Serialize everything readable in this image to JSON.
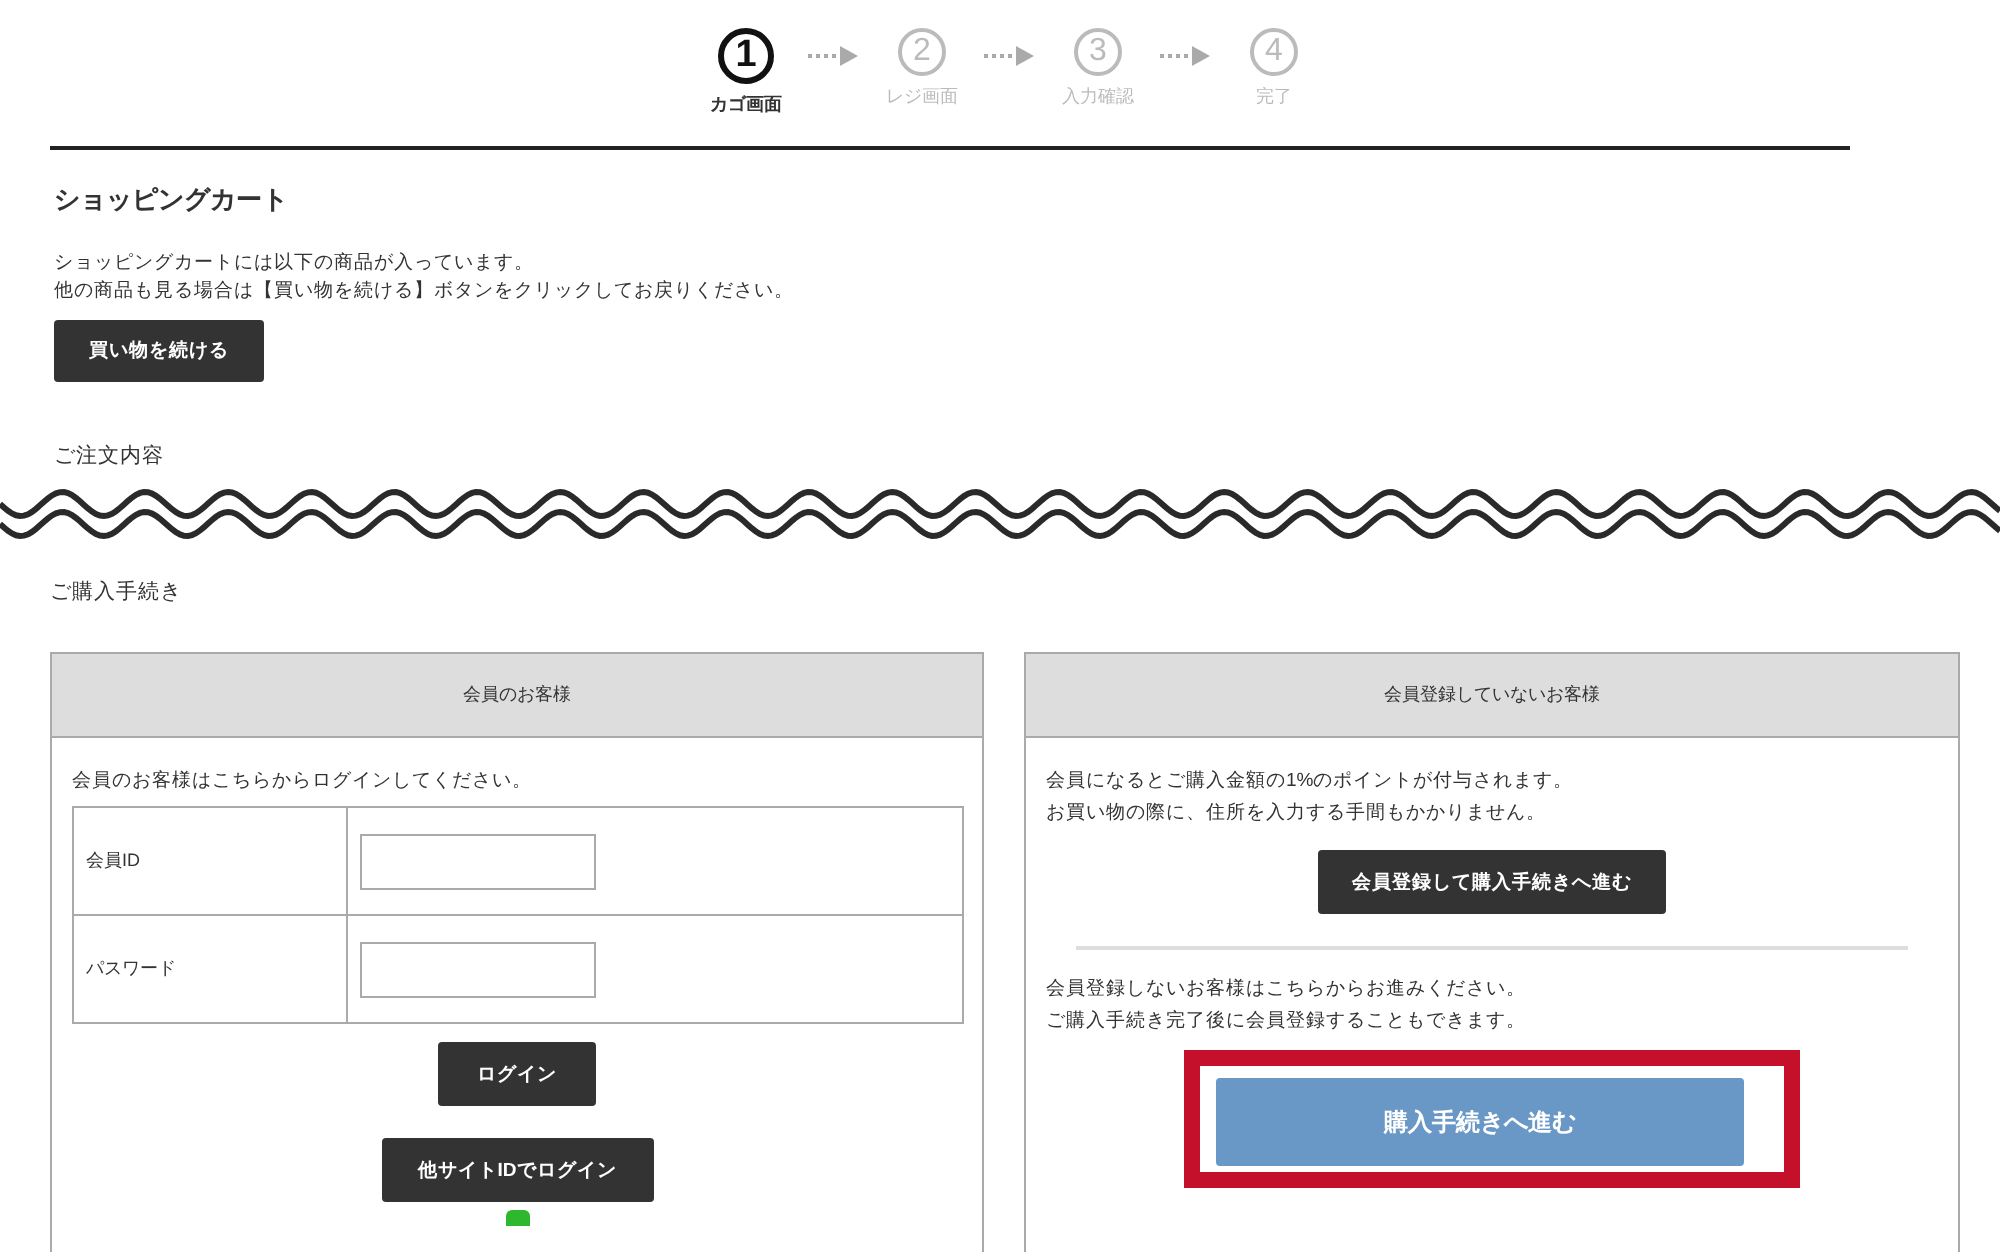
{
  "steps": [
    {
      "number": "1",
      "label": "カゴ画面",
      "selected": true
    },
    {
      "number": "2",
      "label": "レジ画面",
      "selected": false
    },
    {
      "number": "3",
      "label": "入力確認",
      "selected": false
    },
    {
      "number": "4",
      "label": "完了",
      "selected": false
    }
  ],
  "cart": {
    "title": "ショッピングカート",
    "lines": [
      "ショッピングカートには以下の商品が入っています。",
      "他の商品も見る場合は【買い物を続ける】ボタンをクリックしてお戻りください。"
    ],
    "continue_button": "買い物を続ける"
  },
  "order_heading": "ご注文内容",
  "checkout": {
    "heading": "ご購入手続き",
    "member_panel": {
      "title": "会員のお客様",
      "intro": "会員のお客様はこちらからログインしてください。",
      "fields": [
        {
          "label": "会員ID"
        },
        {
          "label": "パスワード"
        }
      ],
      "login_button": "ログイン",
      "other_login_button": "他サイトIDでログイン"
    },
    "guest_panel": {
      "title": "会員登録していないお客様",
      "benefit_lines": [
        "会員になるとご購入金額の1%のポイントが付与されます。",
        "お買い物の際に、住所を入力する手間もかかりません。"
      ],
      "register_button": "会員登録して購入手続きへ進む",
      "guest_lines": [
        "会員登録しないお客様はこちらからお進みください。",
        "ご購入手続き完了後に会員登録することもできます。"
      ],
      "purchase_button": "購入手続きへ進む",
      "highlighted": true
    }
  }
}
